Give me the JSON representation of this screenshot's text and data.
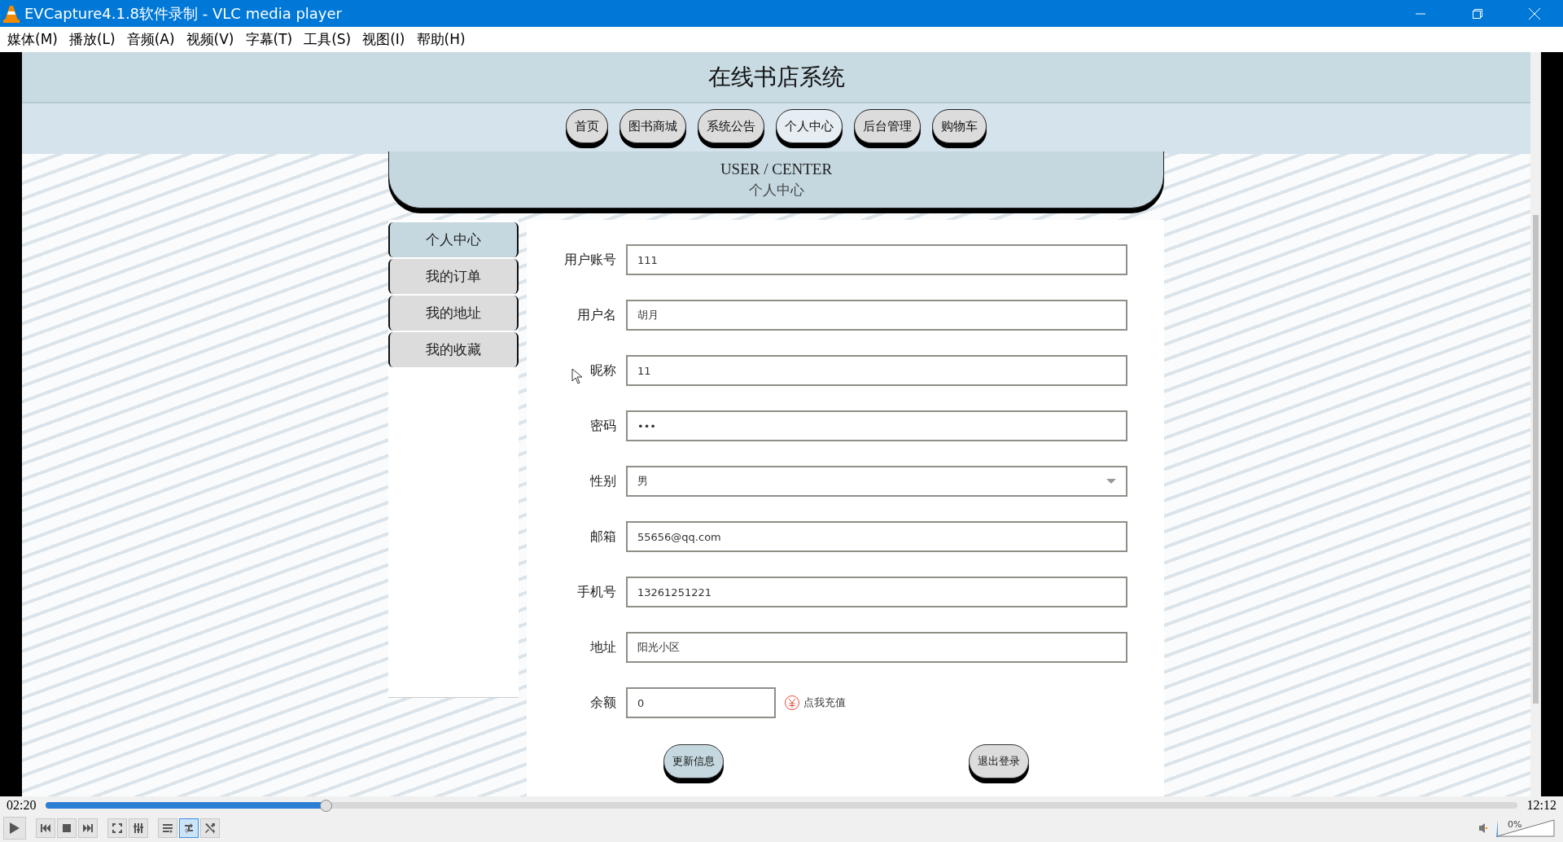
{
  "window": {
    "title": "EVCapture4.1.8软件录制 - VLC media player"
  },
  "menu": [
    "媒体(M)",
    "播放(L)",
    "音频(A)",
    "视频(V)",
    "字幕(T)",
    "工具(S)",
    "视图(I)",
    "帮助(H)"
  ],
  "site": {
    "title": "在线书店系统",
    "nav": [
      {
        "label": "首页",
        "selected": false
      },
      {
        "label": "图书商城",
        "selected": false
      },
      {
        "label": "系统公告",
        "selected": false
      },
      {
        "label": "个人中心",
        "selected": true
      },
      {
        "label": "后台管理",
        "selected": false
      },
      {
        "label": "购物车",
        "selected": false
      }
    ],
    "banner": {
      "title": "USER / CENTER",
      "subtitle": "个人中心"
    },
    "sidebar": [
      {
        "label": "个人中心",
        "selected": true
      },
      {
        "label": "我的订单",
        "selected": false
      },
      {
        "label": "我的地址",
        "selected": false
      },
      {
        "label": "我的收藏",
        "selected": false
      }
    ],
    "form": [
      {
        "kind": "text",
        "label": "用户账号",
        "value": "111"
      },
      {
        "kind": "text",
        "label": "用户名",
        "value": "胡月"
      },
      {
        "kind": "text",
        "label": "昵称",
        "value": "11"
      },
      {
        "kind": "text",
        "label": "密码",
        "value": "•••"
      },
      {
        "kind": "select",
        "label": "性别",
        "value": "男"
      },
      {
        "kind": "text",
        "label": "邮箱",
        "value": "55656@qq.com"
      },
      {
        "kind": "text",
        "label": "手机号",
        "value": "13261251221"
      },
      {
        "kind": "text",
        "label": "地址",
        "value": "阳光小区"
      },
      {
        "kind": "balance",
        "label": "余额",
        "value": "0",
        "link": "点我充值"
      }
    ],
    "buttons": [
      {
        "label": "更新信息",
        "kind": "primary"
      },
      {
        "label": "退出登录",
        "kind": "secondary"
      }
    ]
  },
  "player": {
    "elapsed": "02:20",
    "total": "12:12",
    "progress": {
      "level": 0.19
    },
    "loop": {
      "on": true
    },
    "volume": {
      "reading": "0%",
      "level": 0
    }
  }
}
